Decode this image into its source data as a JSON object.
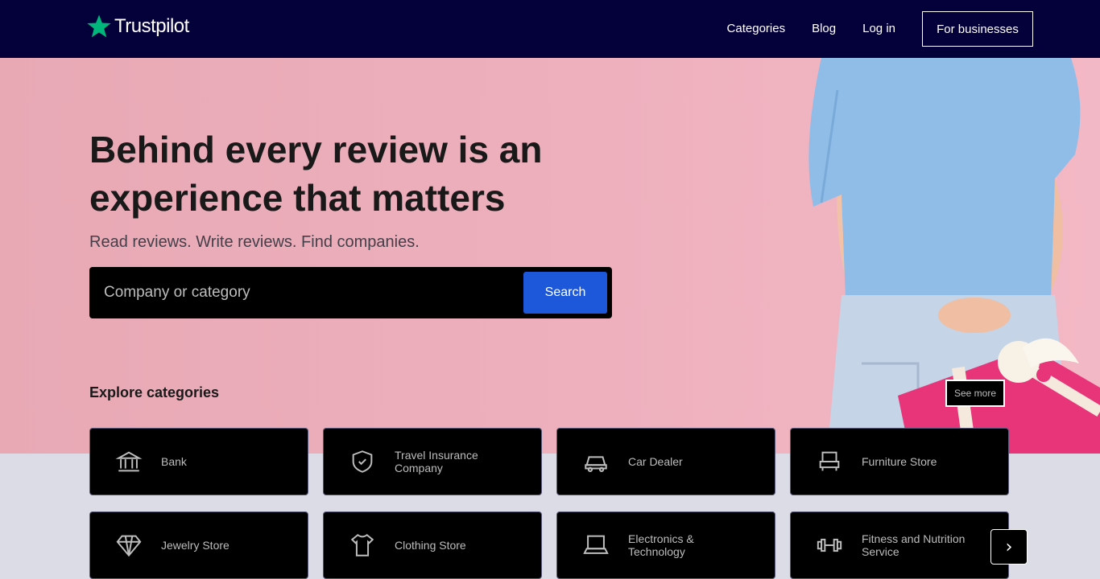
{
  "brand": {
    "name": "Trustpilot",
    "star_color": "#00b67a"
  },
  "nav": {
    "links": [
      "Categories",
      "Blog",
      "Log in"
    ],
    "business_button": "For businesses"
  },
  "hero": {
    "title": "Behind every review is an experience that matters",
    "subtitle": "Read reviews. Write reviews. Find companies.",
    "search": {
      "placeholder": "Company or category",
      "button": "Search"
    },
    "explore_heading": "Explore categories",
    "see_more": "See more"
  },
  "categories": [
    {
      "label": "Bank",
      "icon": "bank-icon"
    },
    {
      "label": "Travel Insurance Company",
      "icon": "shield-icon"
    },
    {
      "label": "Car Dealer",
      "icon": "car-icon"
    },
    {
      "label": "Furniture Store",
      "icon": "furniture-icon"
    },
    {
      "label": "Jewelry Store",
      "icon": "gem-icon"
    },
    {
      "label": "Clothing Store",
      "icon": "shirt-icon"
    },
    {
      "label": "Electronics & Technology",
      "icon": "laptop-icon"
    },
    {
      "label": "Fitness and Nutrition Service",
      "icon": "dumbbell-icon"
    }
  ],
  "colors": {
    "header_bg": "#04003a",
    "hero_bg": "#eeb0bd",
    "search_button": "#1c58d9"
  }
}
